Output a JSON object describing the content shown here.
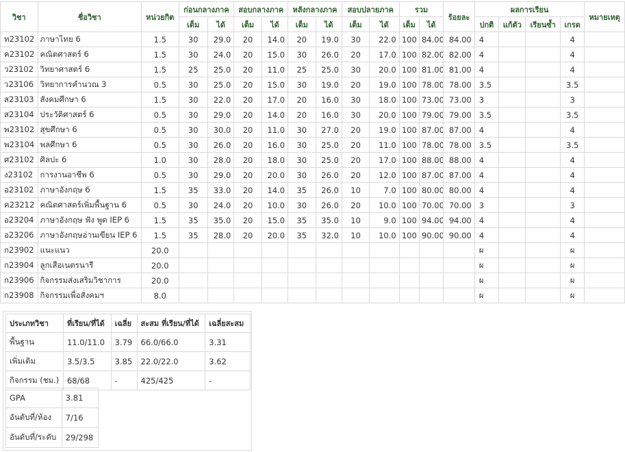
{
  "headers": {
    "code": "วิชา",
    "name": "ชื่อวิชา",
    "credit": "หน่วยกิต",
    "pre_mid": "ก่อนกลางภาค",
    "mid": "สอบกลางภาค",
    "post_mid": "หลังกลางภาค",
    "final": "สอบปลายภาค",
    "total": "รวม",
    "percent": "ร้อยละ",
    "result": "ผลการเรียน",
    "note": "หมายเหตุ",
    "full": "เต็ม",
    "got": "ได้",
    "normal": "ปกติ",
    "fix": "แก้ตัว",
    "repeat": "เรียนซ้ำ",
    "grade": "เกรด"
  },
  "rows": [
    {
      "code": "ท23102",
      "name": "ภาษาไทย 6",
      "credit": "1.5",
      "pre_full": "30",
      "pre_got": "29.0",
      "mid_full": "20",
      "mid_got": "14.0",
      "post_full": "20",
      "post_got": "19.0",
      "fin_full": "30",
      "fin_got": "22.0",
      "tot_full": "100",
      "tot_got": "84.00",
      "percent": "84.00",
      "normal": "4",
      "fix": "",
      "repeat": "",
      "grade": "4",
      "note": ""
    },
    {
      "code": "ค23102",
      "name": "คณิตศาสตร์ 6",
      "credit": "1.5",
      "pre_full": "30",
      "pre_got": "24.0",
      "mid_full": "20",
      "mid_got": "15.0",
      "post_full": "30",
      "post_got": "26.0",
      "fin_full": "20",
      "fin_got": "17.0",
      "tot_full": "100",
      "tot_got": "82.00",
      "percent": "82.00",
      "normal": "4",
      "fix": "",
      "repeat": "",
      "grade": "4",
      "note": ""
    },
    {
      "code": "ว23102",
      "name": "วิทยาศาสตร์ 6",
      "credit": "1.5",
      "pre_full": "25",
      "pre_got": "25.0",
      "mid_full": "20",
      "mid_got": "11.0",
      "post_full": "25",
      "post_got": "25.0",
      "fin_full": "30",
      "fin_got": "20.0",
      "tot_full": "100",
      "tot_got": "81.00",
      "percent": "81.00",
      "normal": "4",
      "fix": "",
      "repeat": "",
      "grade": "4",
      "note": ""
    },
    {
      "code": "ว23106",
      "name": "วิทยาการคำนวณ 3",
      "credit": "0.5",
      "pre_full": "30",
      "pre_got": "25.0",
      "mid_full": "20",
      "mid_got": "15.0",
      "post_full": "30",
      "post_got": "19.0",
      "fin_full": "20",
      "fin_got": "19.0",
      "tot_full": "100",
      "tot_got": "78.00",
      "percent": "78.00",
      "normal": "3.5",
      "fix": "",
      "repeat": "",
      "grade": "3.5",
      "note": ""
    },
    {
      "code": "ส23103",
      "name": "สังคมศึกษา 6",
      "credit": "1.5",
      "pre_full": "30",
      "pre_got": "22.0",
      "mid_full": "20",
      "mid_got": "17.0",
      "post_full": "20",
      "post_got": "16.0",
      "fin_full": "30",
      "fin_got": "18.0",
      "tot_full": "100",
      "tot_got": "73.00",
      "percent": "73.00",
      "normal": "3",
      "fix": "",
      "repeat": "",
      "grade": "3",
      "note": ""
    },
    {
      "code": "ส23104",
      "name": "ประวัติศาสตร์ 6",
      "credit": "0.5",
      "pre_full": "30",
      "pre_got": "29.0",
      "mid_full": "20",
      "mid_got": "14.0",
      "post_full": "20",
      "post_got": "16.0",
      "fin_full": "30",
      "fin_got": "20.0",
      "tot_full": "100",
      "tot_got": "79.00",
      "percent": "79.00",
      "normal": "3.5",
      "fix": "",
      "repeat": "",
      "grade": "3.5",
      "note": ""
    },
    {
      "code": "พ23102",
      "name": "สุขศึกษา 6",
      "credit": "0.5",
      "pre_full": "30",
      "pre_got": "30.0",
      "mid_full": "20",
      "mid_got": "11.0",
      "post_full": "30",
      "post_got": "27.0",
      "fin_full": "20",
      "fin_got": "19.0",
      "tot_full": "100",
      "tot_got": "87.00",
      "percent": "87.00",
      "normal": "4",
      "fix": "",
      "repeat": "",
      "grade": "4",
      "note": ""
    },
    {
      "code": "พ23104",
      "name": "พลศึกษา 6",
      "credit": "0.5",
      "pre_full": "30",
      "pre_got": "26.0",
      "mid_full": "20",
      "mid_got": "16.0",
      "post_full": "30",
      "post_got": "25.0",
      "fin_full": "20",
      "fin_got": "11.0",
      "tot_full": "100",
      "tot_got": "78.00",
      "percent": "78.00",
      "normal": "3.5",
      "fix": "",
      "repeat": "",
      "grade": "3.5",
      "note": ""
    },
    {
      "code": "ศ23102",
      "name": "ศิลปะ 6",
      "credit": "1.0",
      "pre_full": "30",
      "pre_got": "28.0",
      "mid_full": "20",
      "mid_got": "18.0",
      "post_full": "30",
      "post_got": "25.0",
      "fin_full": "20",
      "fin_got": "17.0",
      "tot_full": "100",
      "tot_got": "88.00",
      "percent": "88.00",
      "normal": "4",
      "fix": "",
      "repeat": "",
      "grade": "4",
      "note": ""
    },
    {
      "code": "ง23102",
      "name": "การงานอาชีพ 6",
      "credit": "0.5",
      "pre_full": "30",
      "pre_got": "29.0",
      "mid_full": "20",
      "mid_got": "20.0",
      "post_full": "30",
      "post_got": "26.0",
      "fin_full": "20",
      "fin_got": "12.0",
      "tot_full": "100",
      "tot_got": "87.00",
      "percent": "87.00",
      "normal": "4",
      "fix": "",
      "repeat": "",
      "grade": "4",
      "note": ""
    },
    {
      "code": "อ23102",
      "name": "ภาษาอังกฤษ 6",
      "credit": "1.5",
      "pre_full": "35",
      "pre_got": "33.0",
      "mid_full": "20",
      "mid_got": "14.0",
      "post_full": "35",
      "post_got": "26.0",
      "fin_full": "10",
      "fin_got": "7.0",
      "tot_full": "100",
      "tot_got": "80.00",
      "percent": "80.00",
      "normal": "4",
      "fix": "",
      "repeat": "",
      "grade": "4",
      "note": ""
    },
    {
      "code": "ค23212",
      "name": "คณิตศาสตร์เพิ่มพื้นฐาน 6",
      "credit": "0.5",
      "pre_full": "30",
      "pre_got": "24.0",
      "mid_full": "20",
      "mid_got": "10.0",
      "post_full": "30",
      "post_got": "26.0",
      "fin_full": "20",
      "fin_got": "10.0",
      "tot_full": "100",
      "tot_got": "70.00",
      "percent": "70.00",
      "normal": "3",
      "fix": "",
      "repeat": "",
      "grade": "3",
      "note": ""
    },
    {
      "code": "อ23204",
      "name": "ภาษาอังกฤษ ฟัง พูด IEP 6",
      "credit": "1.5",
      "pre_full": "35",
      "pre_got": "35.0",
      "mid_full": "20",
      "mid_got": "15.0",
      "post_full": "35",
      "post_got": "35.0",
      "fin_full": "10",
      "fin_got": "9.0",
      "tot_full": "100",
      "tot_got": "94.00",
      "percent": "94.00",
      "normal": "4",
      "fix": "",
      "repeat": "",
      "grade": "4",
      "note": ""
    },
    {
      "code": "อ23206",
      "name": "ภาษาอังกฤษอ่านเขียน IEP 6",
      "credit": "1.5",
      "pre_full": "35",
      "pre_got": "28.0",
      "mid_full": "20",
      "mid_got": "20.0",
      "post_full": "35",
      "post_got": "32.0",
      "fin_full": "10",
      "fin_got": "10.0",
      "tot_full": "100",
      "tot_got": "90.00",
      "percent": "90.00",
      "normal": "4",
      "fix": "",
      "repeat": "",
      "grade": "4",
      "note": ""
    },
    {
      "code": "ก23902",
      "name": "แนะแนว",
      "credit": "20.0",
      "pre_full": "",
      "pre_got": "",
      "mid_full": "",
      "mid_got": "",
      "post_full": "",
      "post_got": "",
      "fin_full": "",
      "fin_got": "",
      "tot_full": "",
      "tot_got": "",
      "percent": "",
      "normal": "ผ",
      "fix": "",
      "repeat": "",
      "grade": "ผ",
      "note": ""
    },
    {
      "code": "ก23904",
      "name": "ลูกเสือเนตรนารี",
      "credit": "20.0",
      "pre_full": "",
      "pre_got": "",
      "mid_full": "",
      "mid_got": "",
      "post_full": "",
      "post_got": "",
      "fin_full": "",
      "fin_got": "",
      "tot_full": "",
      "tot_got": "",
      "percent": "",
      "normal": "ผ",
      "fix": "",
      "repeat": "",
      "grade": "ผ",
      "note": ""
    },
    {
      "code": "ก23906",
      "name": "กิจกรรมส่งเสริมวิชาการ",
      "credit": "20.0",
      "pre_full": "",
      "pre_got": "",
      "mid_full": "",
      "mid_got": "",
      "post_full": "",
      "post_got": "",
      "fin_full": "",
      "fin_got": "",
      "tot_full": "",
      "tot_got": "",
      "percent": "",
      "normal": "ผ",
      "fix": "",
      "repeat": "",
      "grade": "ผ",
      "note": ""
    },
    {
      "code": "ก23908",
      "name": "กิจกรรมเพื่อสังคมฯ",
      "credit": "8.0",
      "pre_full": "",
      "pre_got": "",
      "mid_full": "",
      "mid_got": "",
      "post_full": "",
      "post_got": "",
      "fin_full": "",
      "fin_got": "",
      "tot_full": "",
      "tot_got": "",
      "percent": "",
      "normal": "ผ",
      "fix": "",
      "repeat": "",
      "grade": "ผ",
      "note": ""
    }
  ],
  "summary": {
    "headers": {
      "type": "ประเภทวิชา",
      "credits": "ที่เรียน/ที่ได้",
      "avg": "เฉลี่ย",
      "cum_credits": "สะสม ที่เรียน/ที่ได้",
      "cum_avg": "เฉลี่ยสะสม"
    },
    "rows": [
      {
        "type": "พื้นฐาน",
        "credits": "11.0/11.0",
        "avg": "3.79",
        "cum_credits": "66.0/66.0",
        "cum_avg": "3.31"
      },
      {
        "type": "เพิ่มเติม",
        "credits": "3.5/3.5",
        "avg": "3.85",
        "cum_credits": "22.0/22.0",
        "cum_avg": "3.62"
      },
      {
        "type": "กิจกรรม (ชม.)",
        "credits": "68/68",
        "avg": "-",
        "cum_credits": "425/425",
        "cum_avg": "-"
      }
    ]
  },
  "gpa": {
    "gpa_label": "GPA",
    "gpa_value": "3.81",
    "class_rank_label": "อันดับที่/ห้อง",
    "class_rank_value": "7/16",
    "level_rank_label": "อันดับที่/ระดับ",
    "level_rank_value": "29/298"
  }
}
